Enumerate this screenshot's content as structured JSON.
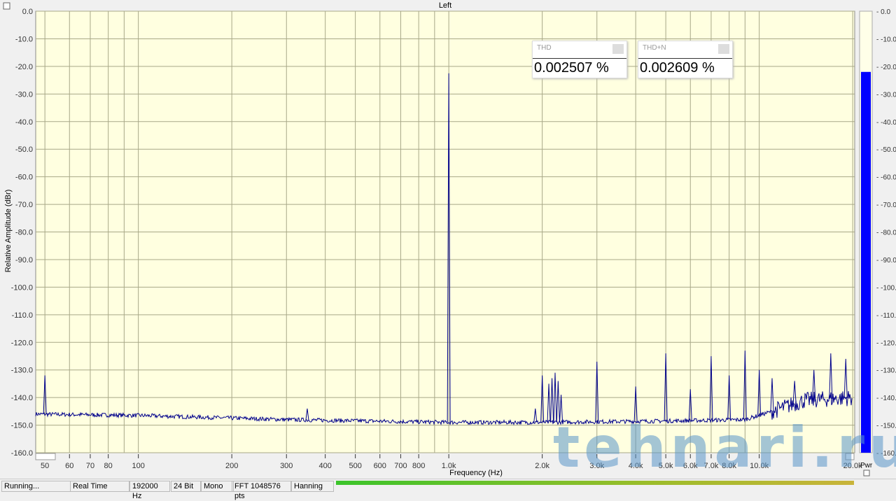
{
  "window": {
    "title": "Left"
  },
  "measurements": [
    {
      "label": "THD",
      "value": "0.002507 %"
    },
    {
      "label": "THD+N",
      "value": "0.002609 %"
    }
  ],
  "status": [
    "Running...",
    "Real Time",
    "192000 Hz",
    "24 Bit",
    "Mono",
    "FFT 1048576 pts",
    "Hanning"
  ],
  "watermark": "tehnari.ru",
  "meter": {
    "label": "Pwr",
    "level_db": -22,
    "color": "#0000ff",
    "ticks": [
      "0.0",
      "-10.0",
      "-20.0",
      "-30.0",
      "-40.0",
      "-50.0",
      "-60.0",
      "-70.0",
      "-80.0",
      "-90.0",
      "-100.0",
      "-110.0",
      "-120.0",
      "-130.0",
      "-140.0",
      "-150.0",
      "-160.0"
    ]
  },
  "chart_data": {
    "type": "line",
    "title": "Left",
    "xlabel": "Frequency (Hz)",
    "ylabel": "Relative Amplitude (dBr)",
    "xscale": "log",
    "xlim": [
      46.7,
      20300
    ],
    "ylim": [
      -160,
      0
    ],
    "grid": true,
    "background": "#ffffe0",
    "line_color": "#00008b",
    "ytick_labels": [
      "0.0",
      "-10.0",
      "-20.0",
      "-30.0",
      "-40.0",
      "-50.0",
      "-60.0",
      "-70.0",
      "-80.0",
      "-90.0",
      "-100.0",
      "-110.0",
      "-120.0",
      "-130.0",
      "-140.0",
      "-150.0",
      "-160.0"
    ],
    "yticks": [
      0,
      -10,
      -20,
      -30,
      -40,
      -50,
      -60,
      -70,
      -80,
      -90,
      -100,
      -110,
      -120,
      -130,
      -140,
      -150,
      -160
    ],
    "xticks": [
      50,
      60,
      70,
      80,
      100,
      200,
      300,
      400,
      500,
      600,
      700,
      800,
      1000,
      2000,
      3000,
      4000,
      5000,
      6000,
      7000,
      8000,
      10000,
      20000
    ],
    "xtick_labels": [
      "50",
      "60",
      "70",
      "80",
      "100",
      "200",
      "300",
      "400",
      "500",
      "600",
      "700",
      "800",
      "1.0k",
      "2.0k",
      "3.0k",
      "4.0k",
      "5.0k",
      "6.0k",
      "7.0k",
      "8.0k",
      "10.0k",
      "20.0k"
    ],
    "xgrid": [
      50,
      60,
      70,
      80,
      90,
      100,
      200,
      300,
      400,
      500,
      600,
      700,
      800,
      900,
      1000,
      2000,
      3000,
      4000,
      5000,
      6000,
      7000,
      8000,
      9000,
      10000,
      20000
    ],
    "noise_floor": [
      [
        46.7,
        -146
      ],
      [
        100,
        -146.5
      ],
      [
        300,
        -148
      ],
      [
        1000,
        -149
      ],
      [
        2000,
        -149
      ],
      [
        5000,
        -148.5
      ],
      [
        9000,
        -148
      ],
      [
        11000,
        -145
      ],
      [
        14000,
        -141
      ],
      [
        20300,
        -140
      ]
    ],
    "peaks": [
      [
        50,
        -132
      ],
      [
        350,
        -144
      ],
      [
        1000,
        -22.5
      ],
      [
        1900,
        -144
      ],
      [
        2000,
        -132
      ],
      [
        2100,
        -135
      ],
      [
        2150,
        -133
      ],
      [
        2200,
        -131
      ],
      [
        2250,
        -134
      ],
      [
        2300,
        -139
      ],
      [
        3000,
        -127
      ],
      [
        4000,
        -136
      ],
      [
        5000,
        -124
      ],
      [
        6000,
        -137
      ],
      [
        7000,
        -125
      ],
      [
        8000,
        -132
      ],
      [
        9000,
        -123
      ],
      [
        10000,
        -130
      ],
      [
        11000,
        -133
      ],
      [
        13000,
        -134
      ],
      [
        15000,
        -130
      ],
      [
        17000,
        -124
      ],
      [
        19000,
        -126
      ]
    ]
  }
}
